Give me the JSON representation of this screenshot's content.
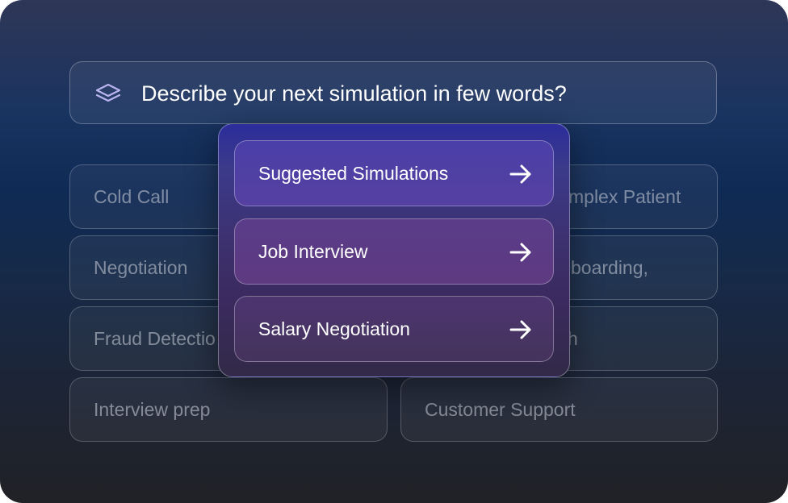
{
  "prompt": {
    "text": "Describe your next simulation in few words?",
    "icon": "layers-icon"
  },
  "chips": [
    {
      "label": "Cold Call"
    },
    {
      "label": "mplex Patient"
    },
    {
      "label": "Negotiation"
    },
    {
      "label": "boarding,"
    },
    {
      "label": "Fraud Detectio"
    },
    {
      "label": "h"
    },
    {
      "label": "Interview prep"
    },
    {
      "label": "Customer Support"
    }
  ],
  "suggestions": [
    {
      "label": "Suggested Simulations",
      "icon": "arrow-right-icon"
    },
    {
      "label": "Job Interview",
      "icon": "arrow-right-icon"
    },
    {
      "label": "Salary Negotiation",
      "icon": "arrow-right-icon"
    }
  ],
  "colors": {
    "background_top": "#2f3657",
    "background_bottom": "#202226",
    "popup_top": "#2c2d9a",
    "text_primary": "#ffffff"
  }
}
